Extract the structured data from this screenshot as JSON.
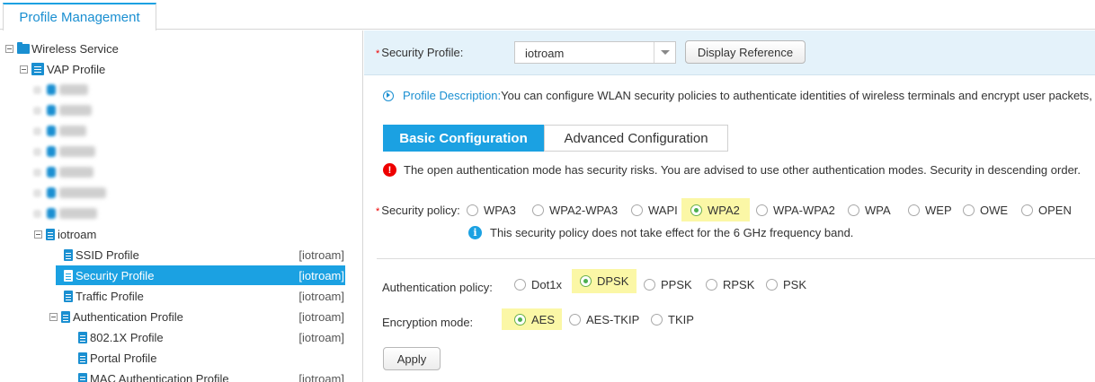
{
  "top_tab": {
    "label": "Profile Management"
  },
  "tree": {
    "wireless_service": "Wireless Service",
    "vap_profile": "VAP Profile",
    "iotroam": "iotroam",
    "ssid_profile": "SSID Profile",
    "security_profile": "Security Profile",
    "traffic_profile": "Traffic Profile",
    "authentication_profile": "Authentication Profile",
    "dot1x_profile": "802.1X Profile",
    "portal_profile": "Portal Profile",
    "mac_auth_profile": "MAC Authentication Profile",
    "tag": "[iotroam]",
    "icons": {
      "folder": "folder-icon",
      "document": "document-icon",
      "expander": "collapse-icon"
    }
  },
  "profile_bar": {
    "label": "Security Profile:",
    "required_mark": "*",
    "selected_value": "iotroam",
    "display_reference_button": "Display Reference"
  },
  "description": {
    "link": "Profile Description:",
    "text": " You can configure WLAN security policies to authenticate identities of wireless terminals and encrypt user packets,"
  },
  "tabs": {
    "basic": "Basic Configuration",
    "advanced": "Advanced Configuration"
  },
  "warning": {
    "icon": "!",
    "text": "The open authentication mode has security risks. You are advised to use other authentication modes. Security in descending order."
  },
  "security_policy": {
    "label": "Security policy:",
    "required_mark": "*",
    "options": [
      "WPA3",
      "WPA2-WPA3",
      "WAPI",
      "WPA2",
      "WPA-WPA2",
      "WPA",
      "WEP",
      "OWE",
      "OPEN"
    ],
    "selected": "WPA2",
    "note_icon": "i",
    "note": "This security policy does not take effect for the 6 GHz frequency band."
  },
  "authentication_policy": {
    "label": "Authentication policy:",
    "options": [
      "Dot1x",
      "DPSK",
      "PPSK",
      "RPSK",
      "PSK"
    ],
    "selected": "DPSK"
  },
  "encryption_mode": {
    "label": "Encryption mode:",
    "options": [
      "AES",
      "AES-TKIP",
      "TKIP"
    ],
    "selected": "AES"
  },
  "apply_button": "Apply",
  "colors": {
    "accent": "#1ba1e2",
    "highlight": "#fbf7a6",
    "radio_on": "#4caf50",
    "error": "#e00000"
  }
}
